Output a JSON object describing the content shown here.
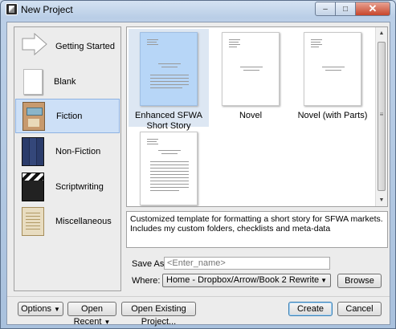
{
  "window": {
    "title": "New Project",
    "min_glyph": "–",
    "max_glyph": "□",
    "close_glyph": "✕"
  },
  "sidebar": {
    "items": [
      {
        "label": "Getting Started",
        "icon": "arrow-icon"
      },
      {
        "label": "Blank",
        "icon": "blank-page-icon"
      },
      {
        "label": "Fiction",
        "icon": "fiction-book-icon",
        "selected": true
      },
      {
        "label": "Non-Fiction",
        "icon": "books-icon"
      },
      {
        "label": "Scriptwriting",
        "icon": "clapperboard-icon"
      },
      {
        "label": "Miscellaneous",
        "icon": "parchment-icon"
      }
    ]
  },
  "templates": {
    "items": [
      {
        "label": "Enhanced SFWA Short Story",
        "selected": true
      },
      {
        "label": "Novel"
      },
      {
        "label": "Novel (with Parts)"
      },
      {
        "label": ""
      }
    ]
  },
  "description": "Customized template for formatting a short story for SFWA markets. Includes my custom folders, checklists and meta-data",
  "form": {
    "save_as_label": "Save As:",
    "save_as_placeholder": "<Enter_name>",
    "where_label": "Where:",
    "where_value": "Home - Dropbox/Arrow/Book 2 Rewrite",
    "browse_label": "Browse"
  },
  "footer": {
    "options_label": "Options",
    "open_recent_label": "Open Recent",
    "open_existing_label": "Open Existing Project...",
    "create_label": "Create",
    "cancel_label": "Cancel"
  },
  "colors": {
    "selection": "#cde0f7",
    "selected_template_page": "#b7d6f7"
  }
}
